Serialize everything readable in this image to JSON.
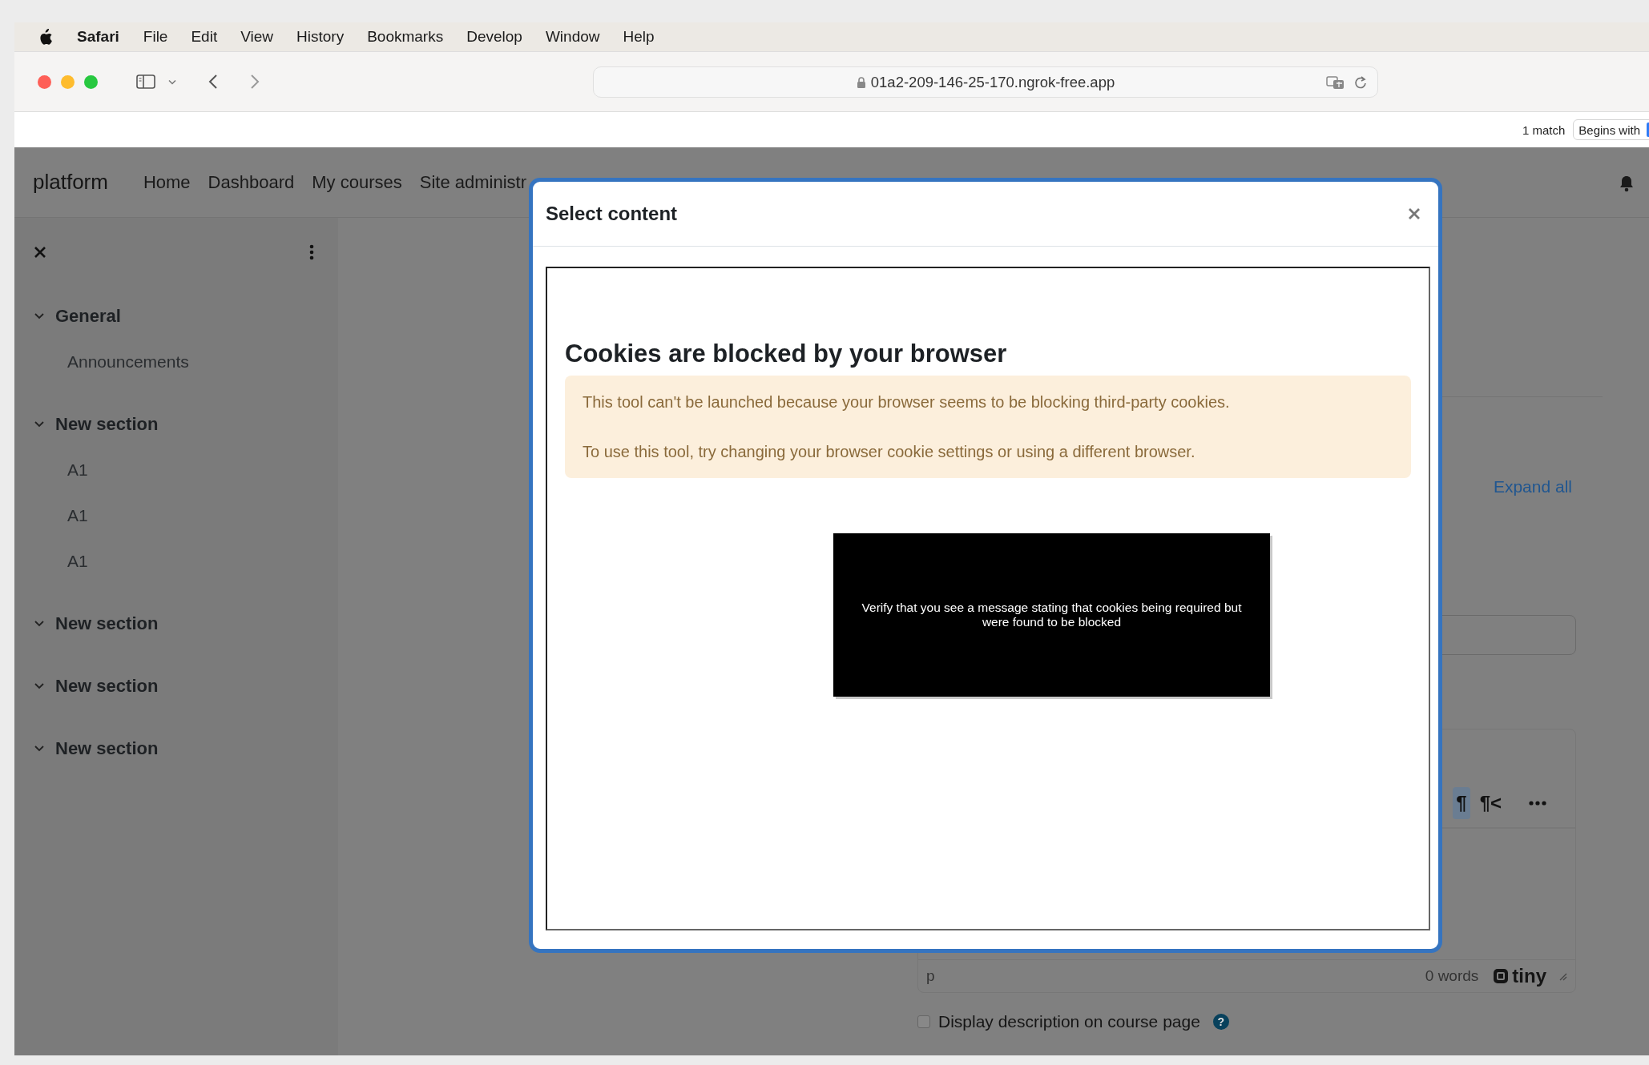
{
  "menu_bar": {
    "app": "Safari",
    "items": [
      "File",
      "Edit",
      "View",
      "History",
      "Bookmarks",
      "Develop",
      "Window",
      "Help"
    ]
  },
  "browser": {
    "url": "01a2-209-146-25-170.ngrok-free.app"
  },
  "find_bar": {
    "matches": "1 match",
    "mode": "Begins with"
  },
  "site": {
    "brand": "platform",
    "nav": [
      "Home",
      "Dashboard",
      "My courses",
      "Site administr"
    ]
  },
  "course_index": {
    "sections": [
      {
        "title": "General",
        "expanded": true,
        "children": [
          {
            "title": "Announcements"
          }
        ]
      },
      {
        "title": "New section",
        "expanded": true,
        "children": [
          {
            "title": "A1"
          },
          {
            "title": "A1"
          },
          {
            "title": "A1"
          }
        ]
      },
      {
        "title": "New section",
        "expanded": true
      },
      {
        "title": "New section",
        "expanded": true
      },
      {
        "title": "New section",
        "expanded": true
      }
    ]
  },
  "main": {
    "expand_all": "Expand all",
    "editor": {
      "toolbar": [
        {
          "label": "¶",
          "selected": true
        },
        {
          "label": "¶<",
          "selected": false
        }
      ],
      "path": "p",
      "word_count": "0 words",
      "brand": "tiny"
    },
    "display_description": {
      "label": "Display description on course page",
      "checked": false,
      "help": "?"
    }
  },
  "modal": {
    "title": "Select content",
    "heading": "Cookies are blocked by your browser",
    "alert": [
      "This tool can't be launched because your browser seems to be blocking third-party cookies.",
      "To use this tool, try changing your browser cookie settings or using a different browser."
    ]
  },
  "annotation": {
    "text": "Verify that you see a message stating that cookies being required but were found to be blocked"
  }
}
